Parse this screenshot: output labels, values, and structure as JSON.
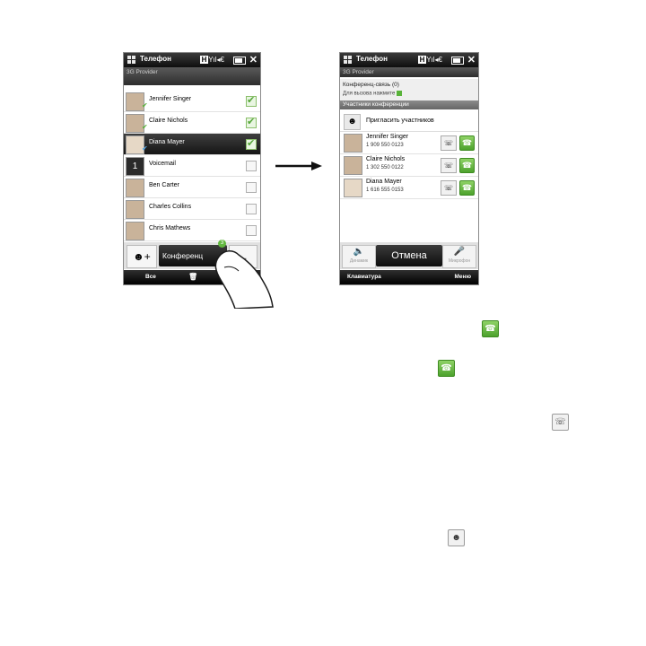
{
  "phone": {
    "app_title": "Телефон",
    "provider": "3G Provider",
    "status_h": "H",
    "status_signal": "Yıl◂€",
    "close_glyph": "✕"
  },
  "left": {
    "contacts": [
      {
        "name": "Jennifer Singer",
        "checked": true
      },
      {
        "name": "Claire Nichols",
        "checked": true
      },
      {
        "name": "Diana Mayer",
        "checked": true,
        "selected": true
      },
      {
        "name": "Voicemail",
        "checked": false,
        "avatar_text": "1"
      },
      {
        "name": "Ben Carter",
        "checked": false
      },
      {
        "name": "Charles Collins",
        "checked": false
      },
      {
        "name": "Chris Mathews",
        "checked": false
      }
    ],
    "add_icon": "add-contact-icon",
    "conference_button": "Конференц",
    "selected_count": "3",
    "back_glyph": "←",
    "softkey_left": "Все",
    "softkey_right_icon": "trash-icon"
  },
  "right": {
    "conference_call": "Конференц-связь (0)",
    "hint": "Для вызова нажмите",
    "members_header": "Участники конференции",
    "invite_label": "Пригласить участников",
    "participants": [
      {
        "name": "Jennifer Singer",
        "phone": "1 909 550 0123"
      },
      {
        "name": "Claire Nichols",
        "phone": "1 302 550 0122"
      },
      {
        "name": "Diana Mayer",
        "phone": "1 616 555 0153"
      }
    ],
    "speaker_label": "Динамик",
    "cancel_button": "Отмена",
    "mute_label": "Микрофон",
    "softkey_left": "Клавиатура",
    "softkey_right": "Меню"
  },
  "doc_icons": {
    "call_icon": "green-phone-icon",
    "merge_icon": "merge-call-icon",
    "invite_icon": "invite-participant-icon"
  }
}
